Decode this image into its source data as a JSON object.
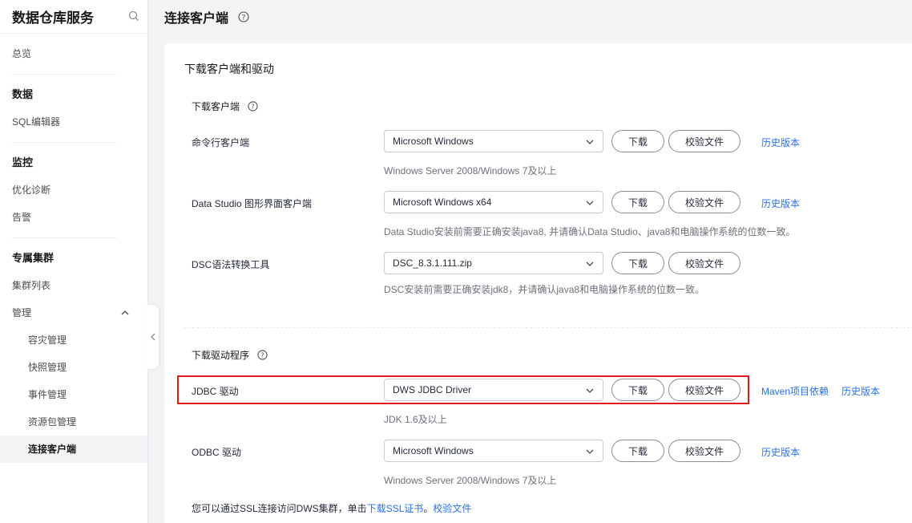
{
  "sidebar": {
    "brand": "数据仓库服务",
    "overview": "总览",
    "section_data": "数据",
    "sql_editor": "SQL编辑器",
    "section_monitor": "监控",
    "optimize": "优化诊断",
    "alarm": "告警",
    "section_cluster": "专属集群",
    "cluster_list": "集群列表",
    "manage": "管理",
    "sub_items": [
      "容灾管理",
      "快照管理",
      "事件管理",
      "资源包管理",
      "连接客户端"
    ]
  },
  "page": {
    "title": "连接客户端"
  },
  "card": {
    "title": "下载客户端和驱动",
    "client_group": "下载客户端",
    "driver_group": "下载驱动程序"
  },
  "rows": [
    {
      "label": "命令行客户端",
      "select": "Microsoft Windows",
      "hint": "Windows Server 2008/Windows 7及以上",
      "download": "下载",
      "verify": "校验文件",
      "links": [
        "历史版本"
      ]
    },
    {
      "label": "Data Studio 图形界面客户端",
      "select": "Microsoft Windows x64",
      "hint": "Data Studio安装前需要正确安装java8, 并请确认Data Studio、java8和电脑操作系统的位数一致。",
      "download": "下载",
      "verify": "校验文件",
      "links": [
        "历史版本"
      ]
    },
    {
      "label": "DSC语法转换工具",
      "select": "DSC_8.3.1.111.zip",
      "hint": "DSC安装前需要正确安装jdk8，并请确认java8和电脑操作系统的位数一致。",
      "download": "下载",
      "verify": "校验文件",
      "links": []
    },
    {
      "label": "JDBC 驱动",
      "select": "DWS JDBC Driver",
      "hint": "JDK 1.6及以上",
      "download": "下载",
      "verify": "校验文件",
      "links": [
        "Maven项目依赖",
        "历史版本"
      ]
    },
    {
      "label": "ODBC 驱动",
      "select": "Microsoft Windows",
      "hint": "Windows Server 2008/Windows 7及以上",
      "download": "下载",
      "verify": "校验文件",
      "links": [
        "历史版本"
      ]
    }
  ],
  "footer": {
    "text": "您可以通过SSL连接访问DWS集群，单击",
    "ssl_link": "下载SSL证书",
    "sep": "。",
    "verify_link": "校验文件"
  },
  "colors": {
    "link": "#2970e8",
    "highlight": "#e01b1b"
  }
}
